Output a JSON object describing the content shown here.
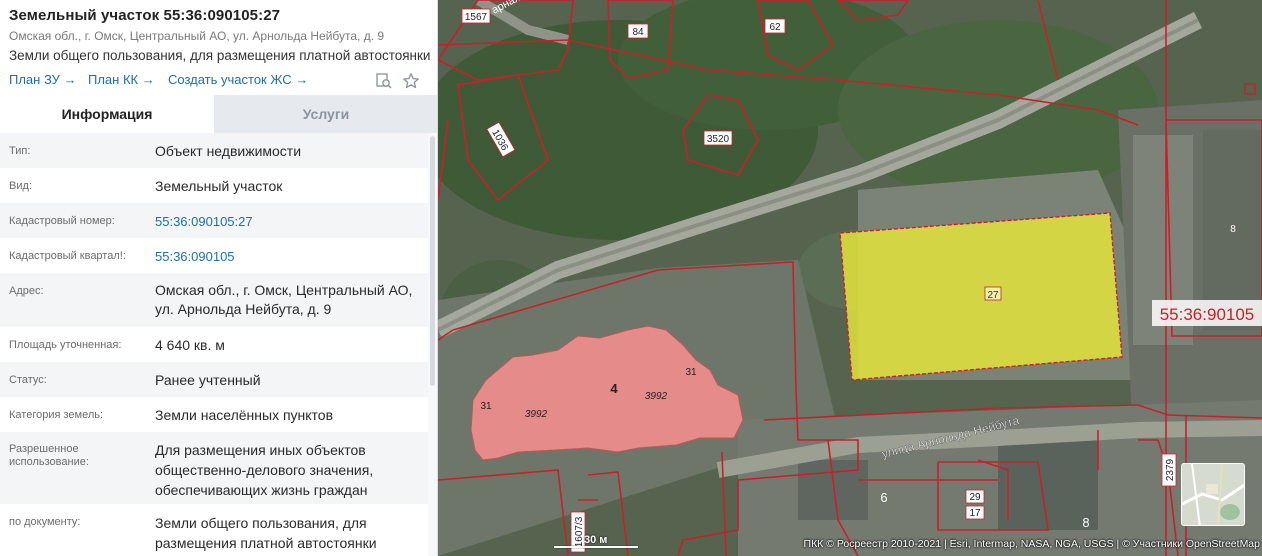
{
  "header": {
    "title": "Земельный участок 55:36:090105:27",
    "subtitle": "Омская обл., г. Омск, Центральный АО, ул. Арнольда Нейбута, д. 9",
    "description": "Земли общего пользования, для размещения платной автостоянки",
    "links": [
      "План ЗУ →",
      "План КК →",
      "Создать участок ЖС →"
    ],
    "icons": [
      "search-document-icon",
      "star-icon"
    ]
  },
  "tabs": {
    "info": "Информация",
    "services": "Услуги"
  },
  "info_rows": [
    {
      "label": "Тип:",
      "value": "Объект недвижимости"
    },
    {
      "label": "Вид:",
      "value": "Земельный участок"
    },
    {
      "label": "Кадастровый номер:",
      "value": "55:36:090105:27"
    },
    {
      "label": "Кадастровый квартал!:",
      "value": "55:36:090105"
    },
    {
      "label": "Адрес:",
      "value_lines": [
        "Омская обл., г. Омск, Центральный АО,",
        "ул. Арнольда Нейбута, д. 9"
      ]
    },
    {
      "label": "Площадь уточненная:",
      "value": "4 640 кв. м"
    },
    {
      "label": "Статус:",
      "value": "Ранее учтенный"
    },
    {
      "label": "Категория земель:",
      "value": "Земли населённых пунктов"
    },
    {
      "label_lines": [
        "Разрешенное",
        "использование:"
      ],
      "value_lines": [
        "Для размещения иных объектов",
        "общественно-делового значения,",
        "обеспечивающих жизнь граждан"
      ]
    },
    {
      "label": "по документу:",
      "value_lines": [
        "Земли общего пользования, для",
        "размещения платной автостоянки"
      ]
    }
  ],
  "map": {
    "highlight_color": "#e8e83a",
    "building_color": "#e58b89",
    "boundary_color": "#c8202a",
    "labels": {
      "plot_27": "27",
      "quarter": "55:36:90105",
      "bld_4": "4",
      "bld_3992a": "3992",
      "bld_3992b": "3992",
      "bld_31a": "31",
      "bld_31b": "31",
      "p_84": "84",
      "p_62": "62",
      "p_3520": "3520",
      "p_1036": "1036",
      "p_1567": "1567",
      "p_8": "8",
      "p_6": "6",
      "p_29": "29",
      "p_17": "17",
      "p_8b": "8",
      "p_2379": "2379",
      "p_1607": "1607/3",
      "street": "улица Арнольда Нейбута",
      "street_fragment": "арная ул"
    },
    "scale": "30 м",
    "attribution": "ПКК © Росреестр 2010-2021 | Esri, Intermap, NASA, NGA, USGS | © Участники OpenStreetMap"
  }
}
